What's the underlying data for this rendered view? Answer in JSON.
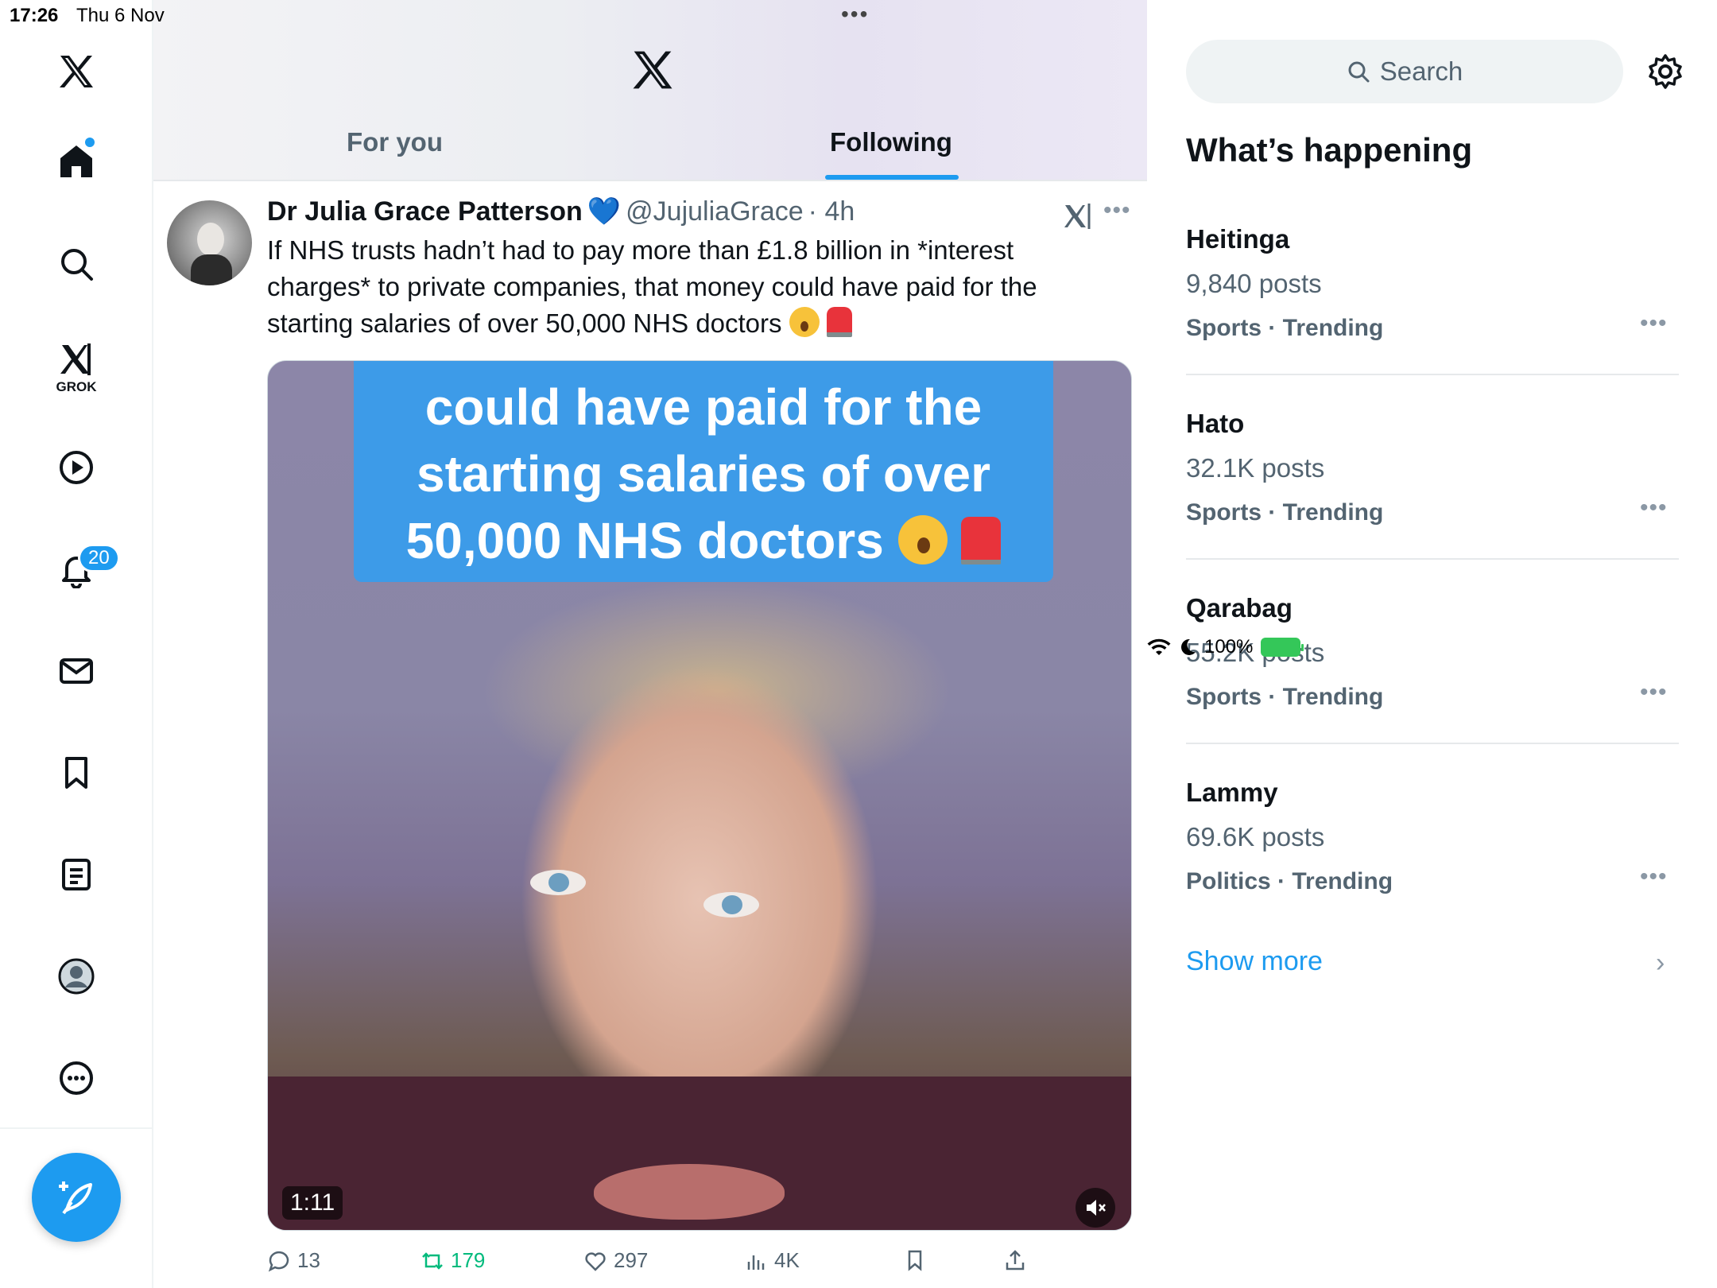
{
  "status_bar": {
    "time": "17:26",
    "date": "Thu 6 Nov",
    "battery": "100%"
  },
  "nav": {
    "grok_label": "GROK",
    "notifications_badge": "20",
    "items": [
      "x-logo",
      "home-icon",
      "search-icon",
      "grok-icon",
      "video-icon",
      "bell-icon",
      "mail-icon",
      "bookmark-icon",
      "list-icon",
      "profile-icon",
      "more-icon"
    ]
  },
  "header": {
    "tabs": [
      {
        "label": "For you",
        "active": false
      },
      {
        "label": "Following",
        "active": true
      }
    ]
  },
  "post": {
    "author": "Dr Julia Grace Patterson",
    "handle": "@JujuliaGrace",
    "time": "· 4h",
    "text": "If NHS trusts hadn’t had to pay more than £1.8 billion in *interest charges* to private companies, that money could have paid for the starting salaries of over 50,000 NHS doctors",
    "video": {
      "caption_line1": "could have paid for the",
      "caption_line2": "starting salaries of over",
      "caption_line3": "50,000 NHS doctors",
      "duration": "1:11"
    },
    "stats": {
      "replies": "13",
      "reposts": "179",
      "likes": "297",
      "views": "4K"
    }
  },
  "sidebar": {
    "search_placeholder": "Search",
    "section_title": "What’s happening",
    "trends": [
      {
        "name": "Heitinga",
        "count": "9,840 posts",
        "meta": "Sports · Trending"
      },
      {
        "name": "Hato",
        "count": "32.1K posts",
        "meta": "Sports · Trending"
      },
      {
        "name": "Qarabag",
        "count": "55.2K posts",
        "meta": "Sports · Trending"
      },
      {
        "name": "Lammy",
        "count": "69.6K posts",
        "meta": "Politics · Trending"
      }
    ],
    "show_more": "Show more"
  },
  "colors": {
    "accent": "#1d9bf0",
    "repost": "#00ba7c",
    "secondary_text": "#536471"
  }
}
